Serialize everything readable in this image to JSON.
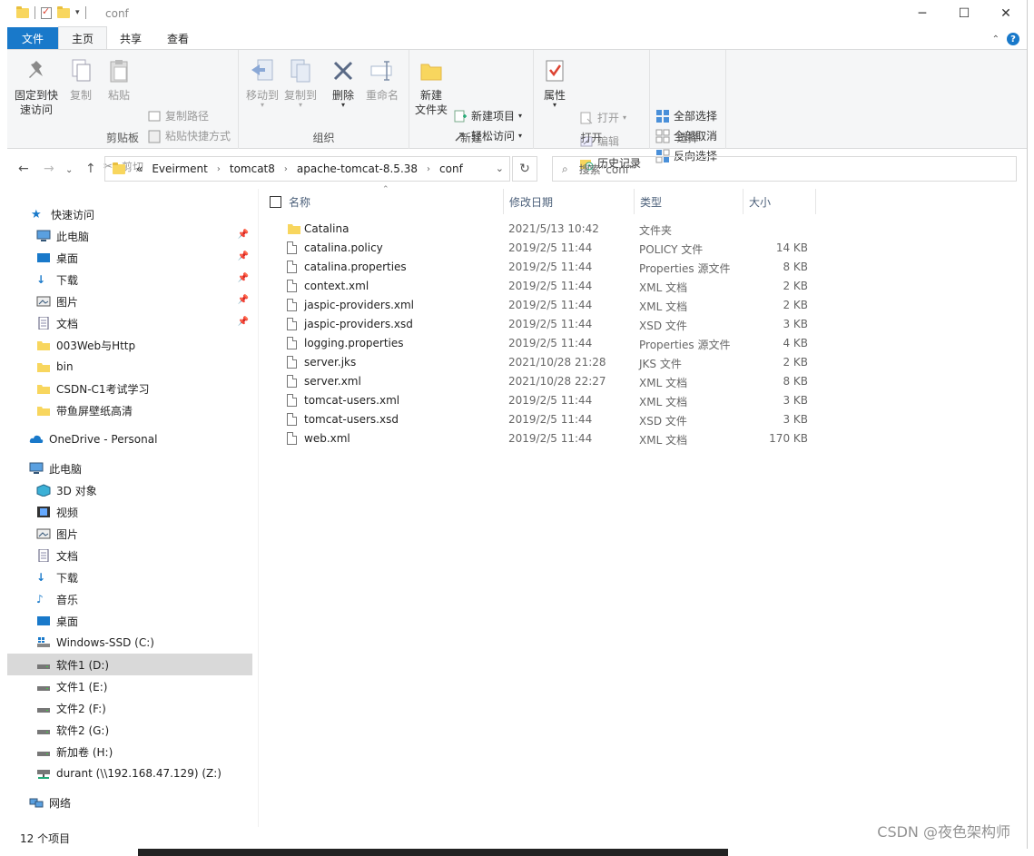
{
  "window": {
    "title": "conf",
    "controls": [
      "─",
      "☐",
      "✕"
    ]
  },
  "ribbon": {
    "tabs": [
      {
        "label": "文件"
      },
      {
        "label": "主页"
      },
      {
        "label": "共享"
      },
      {
        "label": "查看"
      }
    ],
    "groups": {
      "clipboard": {
        "label": "剪贴板",
        "pin": "固定到快\n速访问",
        "copy": "复制",
        "paste": "粘贴",
        "copy_path": "复制路径",
        "paste_shortcut": "粘贴快捷方式",
        "cut": "剪切"
      },
      "organize": {
        "label": "组织",
        "move_to": "移动到",
        "copy_to": "复制到",
        "delete": "删除",
        "rename": "重命名"
      },
      "new": {
        "label": "新建",
        "new_folder": "新建\n文件夹",
        "new_item": "新建项目",
        "easy_access": "轻松访问"
      },
      "open": {
        "label": "打开",
        "properties": "属性",
        "open": "打开",
        "edit": "编辑",
        "history": "历史记录"
      },
      "select": {
        "label": "选择",
        "select_all": "全部选择",
        "select_none": "全部取消",
        "invert": "反向选择"
      }
    }
  },
  "address": {
    "overflow": "«",
    "crumbs": [
      "Eveirment",
      "tomcat8",
      "apache-tomcat-8.5.38",
      "conf"
    ],
    "search_placeholder": "搜索\"conf\""
  },
  "nav": {
    "quick_access": "快速访问",
    "quick_items": [
      "此电脑",
      "桌面",
      "下载",
      "图片",
      "文档",
      "003Web与Http",
      "bin",
      "CSDN-C1考试学习",
      "带鱼屏壁纸高清"
    ],
    "onedrive": "OneDrive - Personal",
    "this_pc": "此电脑",
    "pc_items": [
      "3D 对象",
      "视频",
      "图片",
      "文档",
      "下载",
      "音乐",
      "桌面",
      "Windows-SSD (C:)",
      "软件1 (D:)",
      "文件1 (E:)",
      "文件2 (F:)",
      "软件2 (G:)",
      "新加卷 (H:)",
      "durant (\\\\192.168.47.129) (Z:)"
    ],
    "network": "网络"
  },
  "columns": {
    "name": "名称",
    "date": "修改日期",
    "type": "类型",
    "size": "大小"
  },
  "files": [
    {
      "name": "Catalina",
      "date": "2021/5/13 10:42",
      "type": "文件夹",
      "size": "",
      "kind": "folder"
    },
    {
      "name": "catalina.policy",
      "date": "2019/2/5 11:44",
      "type": "POLICY 文件",
      "size": "14 KB",
      "kind": "doc"
    },
    {
      "name": "catalina.properties",
      "date": "2019/2/5 11:44",
      "type": "Properties 源文件",
      "size": "8 KB",
      "kind": "doc"
    },
    {
      "name": "context.xml",
      "date": "2019/2/5 11:44",
      "type": "XML 文档",
      "size": "2 KB",
      "kind": "doc"
    },
    {
      "name": "jaspic-providers.xml",
      "date": "2019/2/5 11:44",
      "type": "XML 文档",
      "size": "2 KB",
      "kind": "doc"
    },
    {
      "name": "jaspic-providers.xsd",
      "date": "2019/2/5 11:44",
      "type": "XSD 文件",
      "size": "3 KB",
      "kind": "doc"
    },
    {
      "name": "logging.properties",
      "date": "2019/2/5 11:44",
      "type": "Properties 源文件",
      "size": "4 KB",
      "kind": "doc"
    },
    {
      "name": "server.jks",
      "date": "2021/10/28 21:28",
      "type": "JKS 文件",
      "size": "2 KB",
      "kind": "doc"
    },
    {
      "name": "server.xml",
      "date": "2021/10/28 22:27",
      "type": "XML 文档",
      "size": "8 KB",
      "kind": "doc"
    },
    {
      "name": "tomcat-users.xml",
      "date": "2019/2/5 11:44",
      "type": "XML 文档",
      "size": "3 KB",
      "kind": "doc"
    },
    {
      "name": "tomcat-users.xsd",
      "date": "2019/2/5 11:44",
      "type": "XSD 文件",
      "size": "3 KB",
      "kind": "doc"
    },
    {
      "name": "web.xml",
      "date": "2019/2/5 11:44",
      "type": "XML 文档",
      "size": "170 KB",
      "kind": "doc"
    }
  ],
  "status": {
    "count": "12 个项目"
  },
  "watermark": "CSDN @夜色架构师",
  "colors": {
    "accent": "#1979ca",
    "folder": "#f8d65e",
    "selection": "#d9d9d9"
  }
}
